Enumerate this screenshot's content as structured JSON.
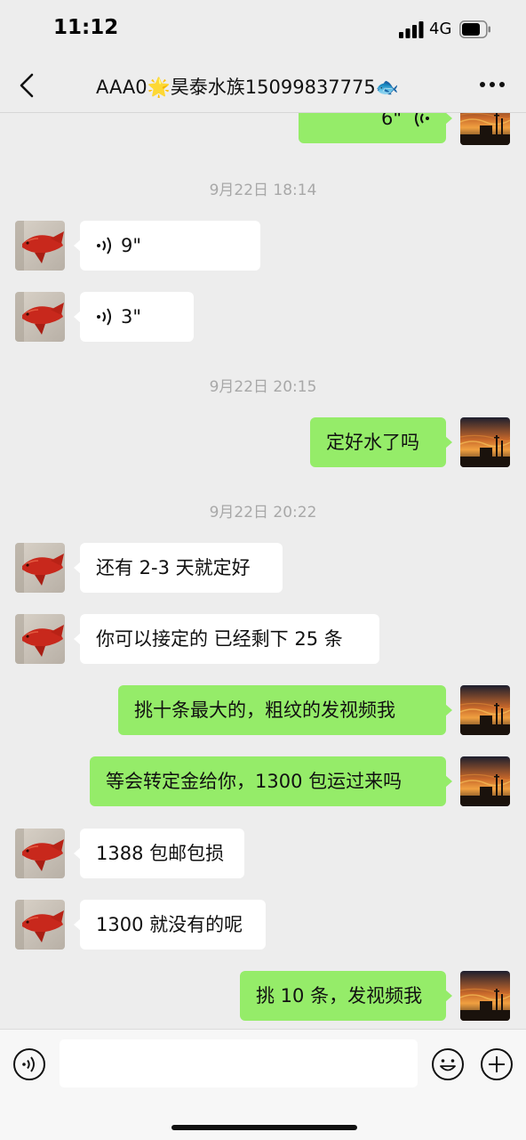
{
  "status_bar": {
    "time": "11:12",
    "network": "4G"
  },
  "header": {
    "title": "AAA0🌟昊泰水族15099837775🐟"
  },
  "messages": [
    {
      "side": "out",
      "kind": "voice",
      "duration": "6\""
    },
    {
      "kind": "timestamp",
      "text": "9月22日 18:14"
    },
    {
      "side": "in",
      "kind": "voice",
      "duration": "9\""
    },
    {
      "side": "in",
      "kind": "voice",
      "duration": "3\""
    },
    {
      "kind": "timestamp",
      "text": "9月22日 20:15"
    },
    {
      "side": "out",
      "kind": "text",
      "text": "定好水了吗"
    },
    {
      "kind": "timestamp",
      "text": "9月22日 20:22"
    },
    {
      "side": "in",
      "kind": "text",
      "text": "还有 2-3 天就定好"
    },
    {
      "side": "in",
      "kind": "text",
      "text": "你可以接定的 已经剩下 25 条"
    },
    {
      "side": "out",
      "kind": "text",
      "text": "挑十条最大的，粗纹的发视频我"
    },
    {
      "side": "out",
      "kind": "text",
      "text": "等会转定金给你，1300 包运过来吗"
    },
    {
      "side": "in",
      "kind": "text",
      "text": "1388 包邮包损"
    },
    {
      "side": "in",
      "kind": "text",
      "text": "1300 就没有的呢"
    },
    {
      "side": "out",
      "kind": "text",
      "text": "挑 10 条，发视频我"
    }
  ],
  "input": {
    "value": "",
    "placeholder": ""
  },
  "icons": {
    "back": "chevron-left-icon",
    "more": "more-dots-icon",
    "voice": "voice-icon",
    "emoji": "emoji-icon",
    "plus": "plus-icon",
    "voice_wave": "voice-wave-icon"
  },
  "colors": {
    "background": "#ededed",
    "outgoing_bubble": "#95ec69",
    "incoming_bubble": "#ffffff",
    "timestamp": "#a8a8a8"
  }
}
